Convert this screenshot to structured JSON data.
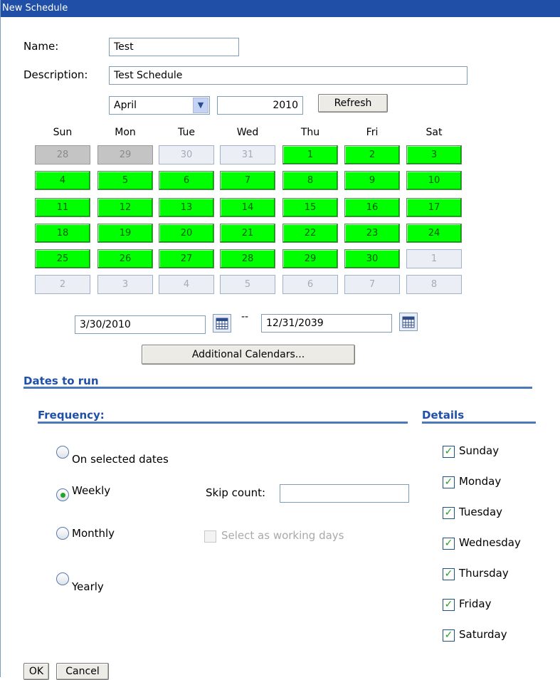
{
  "window": {
    "title": "New Schedule"
  },
  "form": {
    "name_label": "Name:",
    "name_value": "Test",
    "description_label": "Description:",
    "description_value": "Test Schedule",
    "month_selected": "April",
    "year_value": "2010",
    "refresh_label": "Refresh"
  },
  "calendar": {
    "weekdays": [
      "Sun",
      "Mon",
      "Tue",
      "Wed",
      "Thu",
      "Fri",
      "Sat"
    ],
    "weeks": [
      [
        {
          "d": "28",
          "s": "gray"
        },
        {
          "d": "29",
          "s": "gray"
        },
        {
          "d": "30",
          "s": "light"
        },
        {
          "d": "31",
          "s": "light"
        },
        {
          "d": "1",
          "s": "g"
        },
        {
          "d": "2",
          "s": "g"
        },
        {
          "d": "3",
          "s": "g"
        }
      ],
      [
        {
          "d": "4",
          "s": "g"
        },
        {
          "d": "5",
          "s": "g"
        },
        {
          "d": "6",
          "s": "g"
        },
        {
          "d": "7",
          "s": "g"
        },
        {
          "d": "8",
          "s": "g"
        },
        {
          "d": "9",
          "s": "g"
        },
        {
          "d": "10",
          "s": "g"
        }
      ],
      [
        {
          "d": "11",
          "s": "g"
        },
        {
          "d": "12",
          "s": "g"
        },
        {
          "d": "13",
          "s": "g"
        },
        {
          "d": "14",
          "s": "g"
        },
        {
          "d": "15",
          "s": "g"
        },
        {
          "d": "16",
          "s": "g"
        },
        {
          "d": "17",
          "s": "g"
        }
      ],
      [
        {
          "d": "18",
          "s": "g"
        },
        {
          "d": "19",
          "s": "g"
        },
        {
          "d": "20",
          "s": "g"
        },
        {
          "d": "21",
          "s": "g"
        },
        {
          "d": "22",
          "s": "g"
        },
        {
          "d": "23",
          "s": "g"
        },
        {
          "d": "24",
          "s": "g"
        }
      ],
      [
        {
          "d": "25",
          "s": "g"
        },
        {
          "d": "26",
          "s": "g"
        },
        {
          "d": "27",
          "s": "g"
        },
        {
          "d": "28",
          "s": "g"
        },
        {
          "d": "29",
          "s": "g"
        },
        {
          "d": "30",
          "s": "g"
        },
        {
          "d": "1",
          "s": "light"
        }
      ],
      [
        {
          "d": "2",
          "s": "light"
        },
        {
          "d": "3",
          "s": "light"
        },
        {
          "d": "4",
          "s": "light"
        },
        {
          "d": "5",
          "s": "light"
        },
        {
          "d": "6",
          "s": "light"
        },
        {
          "d": "7",
          "s": "light"
        },
        {
          "d": "8",
          "s": "light"
        }
      ]
    ],
    "start_date": "3/30/2010",
    "range_separator": "--",
    "end_date": "12/31/2039",
    "additional_calendars_label": "Additional Calendars..."
  },
  "dates_to_run": {
    "title": "Dates to run",
    "frequency_title": "Frequency:",
    "details_title": "Details",
    "options": [
      {
        "label": "On selected dates",
        "selected": false
      },
      {
        "label": "Weekly",
        "selected": true
      },
      {
        "label": "Monthly",
        "selected": false
      },
      {
        "label": "Yearly",
        "selected": false
      }
    ],
    "skip_count_label": "Skip count:",
    "skip_count_value": "",
    "working_days_label": "Select as working days",
    "days": [
      {
        "label": "Sunday",
        "checked": true
      },
      {
        "label": "Monday",
        "checked": true
      },
      {
        "label": "Tuesday",
        "checked": true
      },
      {
        "label": "Wednesday",
        "checked": true
      },
      {
        "label": "Thursday",
        "checked": true
      },
      {
        "label": "Friday",
        "checked": true
      },
      {
        "label": "Saturday",
        "checked": true
      }
    ]
  },
  "footer": {
    "ok_label": "OK",
    "cancel_label": "Cancel"
  },
  "colors": {
    "title_bar": "#1f4fa6",
    "selected_day": "#00ff00",
    "section_text": "#1f4fa6"
  }
}
